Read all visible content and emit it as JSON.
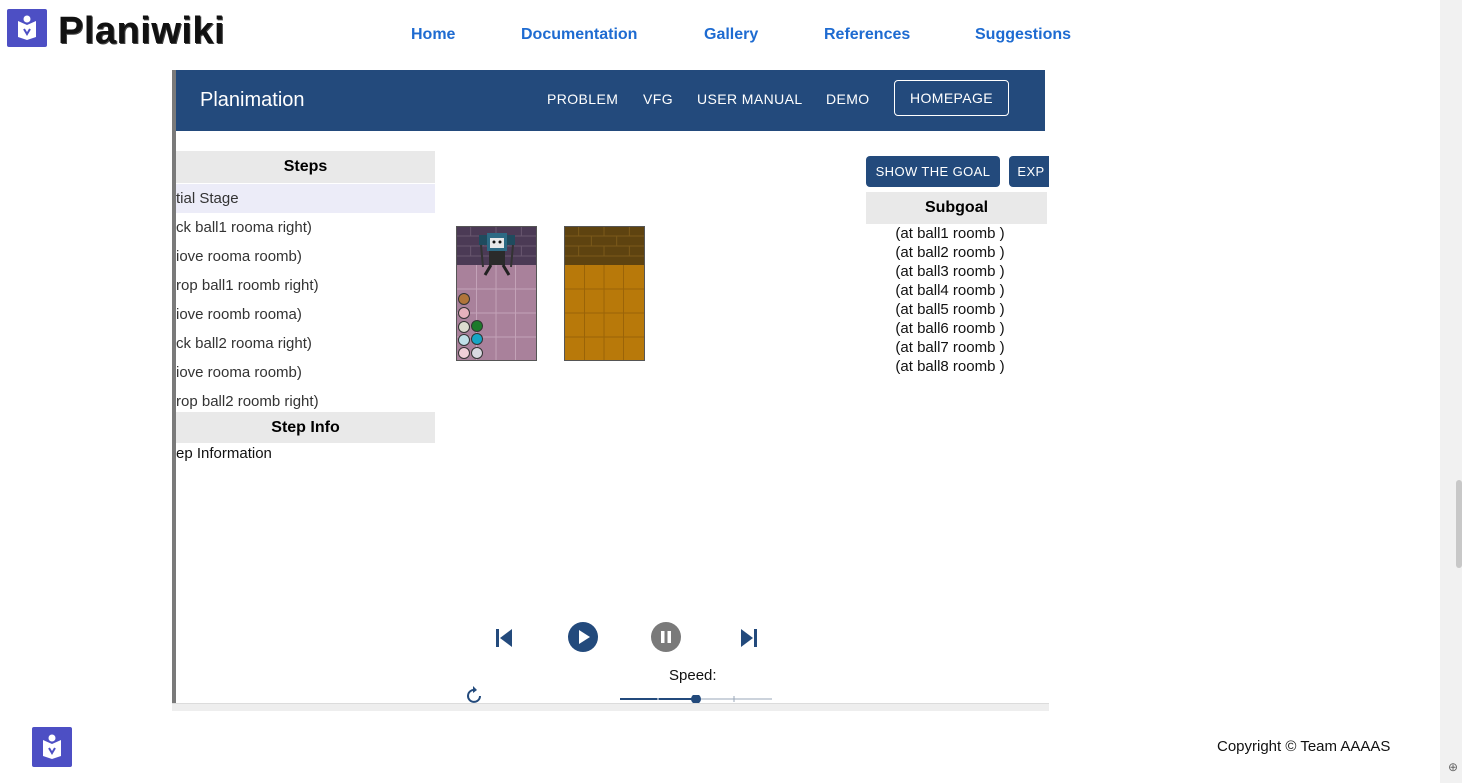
{
  "site": {
    "brand": "Planiwiki",
    "nav": [
      "Home",
      "Documentation",
      "Gallery",
      "References",
      "Suggestions"
    ],
    "copyright": "Copyright © Team AAAAS"
  },
  "app": {
    "title": "Planimation",
    "nav": [
      "PROBLEM",
      "VFG",
      "USER MANUAL",
      "DEMO"
    ],
    "homepage_label": "HOMEPAGE",
    "steps_header": "Steps",
    "steps": [
      "tial Stage",
      "ck ball1 rooma right)",
      "iove rooma roomb)",
      "rop ball1 roomb right)",
      "iove roomb rooma)",
      "ck ball2 rooma right)",
      "iove rooma roomb)",
      "rop ball2 roomb right)"
    ],
    "step_info_header": "Step Info",
    "step_info_text": "ep Information",
    "show_goal_label": "SHOW THE GOAL",
    "export_label": "EXP",
    "subgoal_header": "Subgoal",
    "subgoals": [
      "(at ball1 roomb )",
      "(at ball2 roomb )",
      "(at ball3 roomb )",
      "(at ball4 roomb )",
      "(at ball5 roomb )",
      "(at ball6 roomb )",
      "(at ball7 roomb )",
      "(at ball8 roomb )"
    ],
    "speed_label": "Speed:",
    "speed_value": 0.5,
    "controls": [
      "skip-back-icon",
      "play-icon",
      "pause-icon",
      "skip-forward-icon",
      "reset-icon"
    ],
    "colors": {
      "app_bar": "#234a7c",
      "brand_icon": "#4d4fc4",
      "nav_link": "#1e6bd1"
    }
  }
}
